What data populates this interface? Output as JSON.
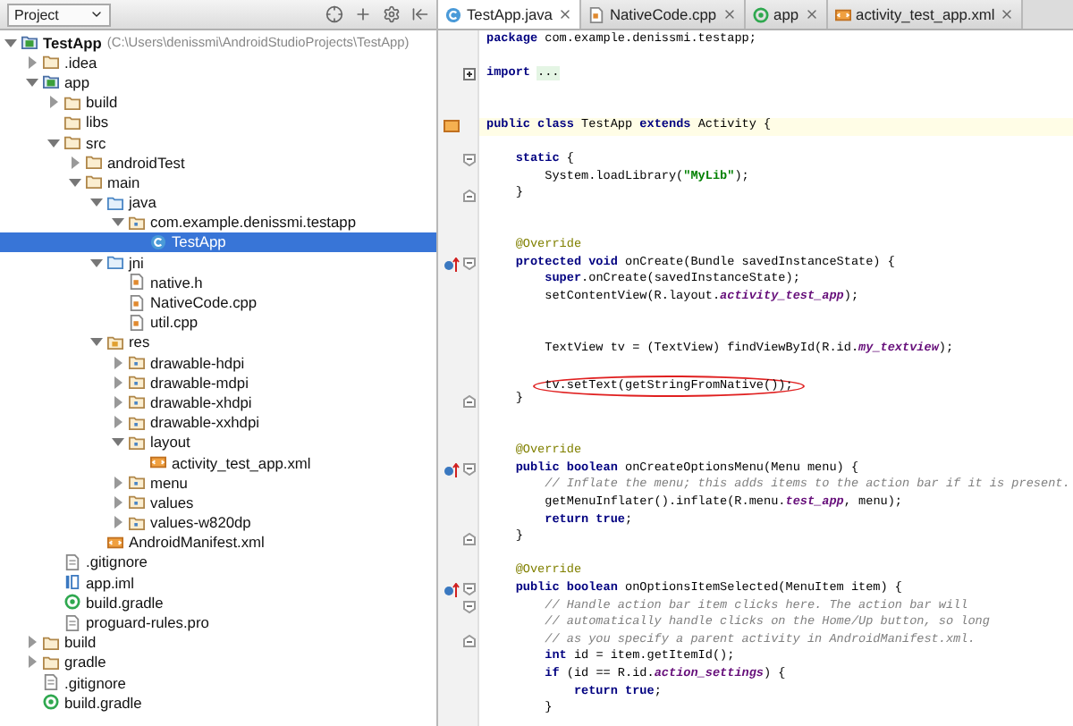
{
  "project_panel": {
    "title": "Project",
    "tree": [
      {
        "label": "TestApp",
        "path": "(C:\\Users\\denissmi\\AndroidStudioProjects\\TestApp)",
        "kind": "module",
        "expanded": true,
        "selected": false,
        "children": [
          {
            "label": ".idea",
            "kind": "folder",
            "expanded": false,
            "selected": false
          },
          {
            "label": "app",
            "kind": "module",
            "expanded": true,
            "selected": false,
            "children": [
              {
                "label": "build",
                "kind": "folder",
                "expanded": false,
                "selected": false
              },
              {
                "label": "libs",
                "kind": "folder",
                "selected": false
              },
              {
                "label": "src",
                "kind": "folder",
                "expanded": true,
                "selected": false,
                "children": [
                  {
                    "label": "androidTest",
                    "kind": "folder",
                    "expanded": false,
                    "selected": false
                  },
                  {
                    "label": "main",
                    "kind": "folder",
                    "expanded": true,
                    "selected": false,
                    "children": [
                      {
                        "label": "java",
                        "kind": "source",
                        "expanded": true,
                        "selected": false,
                        "children": [
                          {
                            "label": "com.example.denissmi.testapp",
                            "kind": "package",
                            "expanded": true,
                            "selected": false,
                            "children": [
                              {
                                "label": "TestApp",
                                "kind": "class",
                                "selected": true
                              }
                            ]
                          }
                        ]
                      },
                      {
                        "label": "jni",
                        "kind": "source",
                        "expanded": true,
                        "selected": false,
                        "children": [
                          {
                            "label": "native.h",
                            "kind": "cfile",
                            "selected": false
                          },
                          {
                            "label": "NativeCode.cpp",
                            "kind": "cfile",
                            "selected": false
                          },
                          {
                            "label": "util.cpp",
                            "kind": "cfile",
                            "selected": false
                          }
                        ]
                      },
                      {
                        "label": "res",
                        "kind": "res",
                        "expanded": true,
                        "selected": false,
                        "children": [
                          {
                            "label": "drawable-hdpi",
                            "kind": "package",
                            "expanded": false,
                            "selected": false
                          },
                          {
                            "label": "drawable-mdpi",
                            "kind": "package",
                            "expanded": false,
                            "selected": false
                          },
                          {
                            "label": "drawable-xhdpi",
                            "kind": "package",
                            "expanded": false,
                            "selected": false
                          },
                          {
                            "label": "drawable-xxhdpi",
                            "kind": "package",
                            "expanded": false,
                            "selected": false
                          },
                          {
                            "label": "layout",
                            "kind": "package",
                            "expanded": true,
                            "selected": false,
                            "children": [
                              {
                                "label": "activity_test_app.xml",
                                "kind": "xml",
                                "selected": false
                              }
                            ]
                          },
                          {
                            "label": "menu",
                            "kind": "package",
                            "expanded": false,
                            "selected": false
                          },
                          {
                            "label": "values",
                            "kind": "package",
                            "expanded": false,
                            "selected": false
                          },
                          {
                            "label": "values-w820dp",
                            "kind": "package",
                            "expanded": false,
                            "selected": false
                          }
                        ]
                      },
                      {
                        "label": "AndroidManifest.xml",
                        "kind": "xml",
                        "selected": false
                      }
                    ]
                  }
                ]
              },
              {
                "label": ".gitignore",
                "kind": "text",
                "selected": false
              },
              {
                "label": "app.iml",
                "kind": "iml",
                "selected": false
              },
              {
                "label": "build.gradle",
                "kind": "gradle",
                "selected": false
              },
              {
                "label": "proguard-rules.pro",
                "kind": "text",
                "selected": false
              }
            ]
          },
          {
            "label": "build",
            "kind": "folder",
            "expanded": false,
            "selected": false
          },
          {
            "label": "gradle",
            "kind": "folder",
            "expanded": false,
            "selected": false
          },
          {
            "label": ".gitignore",
            "kind": "text",
            "selected": false
          },
          {
            "label": "build.gradle",
            "kind": "gradle",
            "selected": false
          }
        ]
      }
    ]
  },
  "tabs": [
    {
      "label": "TestApp.java",
      "kind": "class",
      "selected": true
    },
    {
      "label": "NativeCode.cpp",
      "kind": "cfile",
      "selected": false
    },
    {
      "label": "app",
      "kind": "gradle",
      "selected": false
    },
    {
      "label": "activity_test_app.xml",
      "kind": "xml",
      "selected": false
    }
  ],
  "editor": {
    "lines": [
      {
        "segments": [
          {
            "text": "package",
            "kind": "kw"
          },
          {
            "text": " com.example.denissmi.testapp;",
            "kind": "plain"
          }
        ]
      },
      {
        "blank_line_before": true,
        "folded": true,
        "segments": [
          {
            "text": "import",
            "kind": "kw"
          },
          {
            "text": "...",
            "kind": "folded"
          }
        ]
      },
      {
        "two_blank_lines_before": true,
        "highlighted": true,
        "class_marker": true,
        "segments": [
          {
            "text": "public class",
            "kind": "kw"
          },
          {
            "text": " TestApp ",
            "kind": "plain"
          },
          {
            "text": "extends",
            "kind": "kw"
          },
          {
            "text": " Activity {",
            "kind": "plain"
          }
        ]
      },
      {
        "blank_line_before": true,
        "fold_start": true,
        "segments": [
          {
            "text": "    static",
            "kind": "kw"
          },
          {
            "text": " {",
            "kind": "plain"
          }
        ]
      },
      {
        "segments": [
          {
            "text": "        System.loadLibrary(",
            "kind": "plain"
          },
          {
            "text": "\"MyLib\"",
            "kind": "str"
          },
          {
            "text": ");",
            "kind": "plain"
          }
        ]
      },
      {
        "fold_end": true,
        "segments": [
          {
            "text": "    }",
            "kind": "plain"
          }
        ]
      },
      {
        "two_blank_lines_before": true,
        "segments": [
          {
            "text": "    @Override",
            "kind": "ann"
          }
        ]
      },
      {
        "override_marker": true,
        "fold_start": true,
        "segments": [
          {
            "text": "    protected void",
            "kind": "kw"
          },
          {
            "text": " onCreate(Bundle savedInstanceState) {",
            "kind": "plain"
          }
        ]
      },
      {
        "segments": [
          {
            "text": "        super",
            "kind": "kw"
          },
          {
            "text": ".onCreate(savedInstanceState);",
            "kind": "plain"
          }
        ]
      },
      {
        "segments": [
          {
            "text": "        setContentView(R.layout.",
            "kind": "plain"
          },
          {
            "text": "activity_test_app",
            "kind": "field"
          },
          {
            "text": ");",
            "kind": "plain"
          }
        ]
      },
      {
        "two_blank_lines_before": true,
        "segments": [
          {
            "text": "        TextView tv = (TextView) findViewById(R.id.",
            "kind": "plain"
          },
          {
            "text": "my_textview",
            "kind": "field"
          },
          {
            "text": ");",
            "kind": "plain"
          }
        ]
      },
      {
        "blank_line_before": true,
        "circled": true,
        "segments": [
          {
            "text": "        tv.setText(getStringFromNative());",
            "kind": "plain"
          }
        ]
      },
      {
        "fold_end": true,
        "segments": [
          {
            "text": "    }",
            "kind": "plain"
          }
        ]
      },
      {
        "two_blank_lines_before": true,
        "segments": [
          {
            "text": "    @Override",
            "kind": "ann"
          }
        ]
      },
      {
        "override_marker": true,
        "fold_start": true,
        "segments": [
          {
            "text": "    public boolean",
            "kind": "kw"
          },
          {
            "text": " onCreateOptionsMenu(Menu menu) {",
            "kind": "plain"
          }
        ]
      },
      {
        "segments": [
          {
            "text": "        // Inflate the menu; this adds items to the action bar if it is present.",
            "kind": "cmt"
          }
        ]
      },
      {
        "segments": [
          {
            "text": "        getMenuInflater().inflate(R.menu.",
            "kind": "plain"
          },
          {
            "text": "test_app",
            "kind": "field"
          },
          {
            "text": ", menu);",
            "kind": "plain"
          }
        ]
      },
      {
        "segments": [
          {
            "text": "        return true",
            "kind": "kw"
          },
          {
            "text": ";",
            "kind": "plain"
          }
        ]
      },
      {
        "fold_end": true,
        "segments": [
          {
            "text": "    }",
            "kind": "plain"
          }
        ]
      },
      {
        "blank_line_before": true,
        "segments": [
          {
            "text": "    @Override",
            "kind": "ann"
          }
        ]
      },
      {
        "override_marker": true,
        "fold_start": true,
        "segments": [
          {
            "text": "    public boolean",
            "kind": "kw"
          },
          {
            "text": " onOptionsItemSelected(MenuItem item) {",
            "kind": "plain"
          }
        ]
      },
      {
        "fold_start": true,
        "segments": [
          {
            "text": "        // Handle action bar item clicks here. The action bar will",
            "kind": "cmt"
          }
        ]
      },
      {
        "segments": [
          {
            "text": "        // automatically handle clicks on the Home/Up button, so long",
            "kind": "cmt"
          }
        ]
      },
      {
        "fold_end": true,
        "segments": [
          {
            "text": "        // as you specify a parent activity in AndroidManifest.xml.",
            "kind": "cmt"
          }
        ]
      },
      {
        "segments": [
          {
            "text": "        int",
            "kind": "kw"
          },
          {
            "text": " id = item.getItemId();",
            "kind": "plain"
          }
        ]
      },
      {
        "segments": [
          {
            "text": "        if",
            "kind": "kw"
          },
          {
            "text": " (id == R.id.",
            "kind": "plain"
          },
          {
            "text": "action_settings",
            "kind": "field"
          },
          {
            "text": ") {",
            "kind": "plain"
          }
        ]
      },
      {
        "segments": [
          {
            "text": "            return true",
            "kind": "kw"
          },
          {
            "text": ";",
            "kind": "plain"
          }
        ]
      },
      {
        "segments": [
          {
            "text": "        }",
            "kind": "plain"
          }
        ]
      }
    ]
  }
}
